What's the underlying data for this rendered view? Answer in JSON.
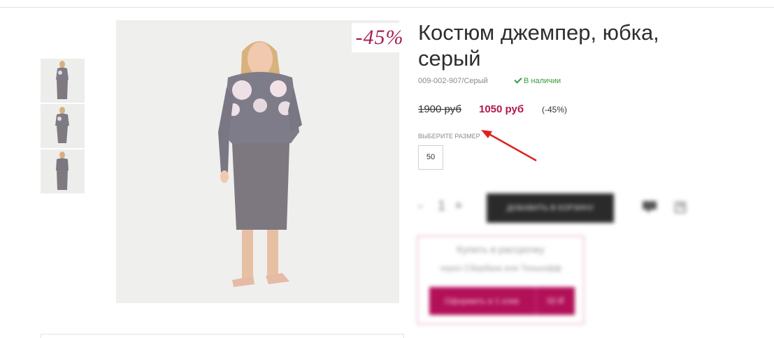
{
  "product": {
    "title": "Костюм джемпер, юбка, серый",
    "sku": "009-002-907/Серый",
    "stock": "В наличии",
    "old_price": "1900 руб",
    "new_price": "1050 руб",
    "discount_pct": "(-45%)",
    "badge": "-45%",
    "size_label": "ВЫБЕРИТЕ РАЗМЕР",
    "sizes": [
      "50"
    ]
  },
  "cart": {
    "qty_minus": "-",
    "qty_value": "1",
    "qty_plus": "+",
    "buy_label": "ДОБАВИТЬ В КОРЗИНУ"
  },
  "promo": {
    "title": "Купить в рассрочку",
    "subtitle": "через Сбербанк или Тинькофф",
    "button_label": "Оформить в 1 клик",
    "button_value": "50 ₽"
  },
  "colors": {
    "accent": "#b0174f",
    "badge": "#a61e53",
    "in_stock": "#3a9a3a",
    "buy_button": "#2a2a2a",
    "arrow": "#e02020"
  }
}
